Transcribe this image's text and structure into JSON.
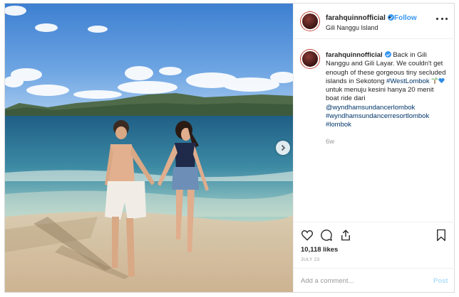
{
  "post": {
    "username": "farahquinnofficial",
    "follow_label": "Follow",
    "separator": "•",
    "location": "Gili Nanggu Island",
    "caption": {
      "username": "farahquinnofficial",
      "text_1": "Back in Gili Nanggu and Gili Layar. We couldn't get enough of these gorgeous tiny secluded islands in Sekotong",
      "hashtag_westlombok": "#WestLombok",
      "text_2": "untuk menuju kesini hanya 20 menit boat ride dari",
      "mention": "@wyndhamsundancerlombok",
      "hashtag_resort": "#wyndhamsundancerresortlombok",
      "hashtag_lombok": "#lombok"
    },
    "time_ago": "6w",
    "likes": "10,118 likes",
    "date": "JULY 23",
    "comment_placeholder": "Add a comment...",
    "post_label": "Post",
    "icons": {
      "like": "heart-icon",
      "comment": "comment-icon",
      "share": "share-icon",
      "save": "bookmark-icon",
      "next": "chevron-right-icon",
      "more": "more-options-icon"
    },
    "colors": {
      "link_blue": "#3897f0",
      "hashtag": "#003569",
      "muted": "#999999",
      "border": "#dbdbdb"
    }
  }
}
